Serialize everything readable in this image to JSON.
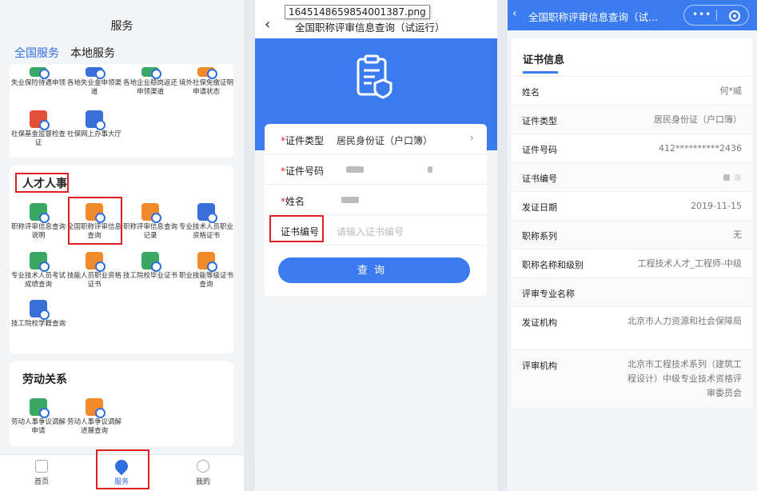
{
  "panel1": {
    "title": "服务",
    "tabs": [
      "全国服务",
      "本地服务"
    ],
    "top_items": [
      "失业保险待遇申领",
      "各地失业金申领渠道",
      "各地企业稳岗返还申领渠道",
      "境外社保免缴证明申请状态",
      "社保基金监督检查证",
      "社保网上办事大厅"
    ],
    "section_talent": "人才人事",
    "talent_items": [
      "职称评审信息查询说明",
      "全国职称评审信息查询",
      "职称评审信息查询记录",
      "专业技术人员职业资格证书",
      "专业技术人员考试成绩查询",
      "技能人员职业资格证书",
      "技工院校毕业证书",
      "职业技能等级证书查询",
      "技工院校学籍查询"
    ],
    "section_labor": "劳动关系",
    "labor_items": [
      "劳动人事争议调解申请",
      "劳动人事争议调解进展查询"
    ],
    "nav": [
      "首页",
      "服务",
      "我的"
    ]
  },
  "panel2": {
    "tooltip": "1645148659854001387.png",
    "title": "全国职称评审信息查询（试运行）",
    "form": {
      "type_label": "证件类型",
      "type_value": "居民身份证（户口簿）",
      "id_label": "证件号码",
      "name_label": "姓名",
      "cert_label": "证书编号",
      "cert_placeholder": "请输入证书编号",
      "query_button": "查询"
    }
  },
  "panel3": {
    "title": "全国职称评审信息查询（试...",
    "tab": "证书信息",
    "rows": [
      {
        "k": "姓名",
        "v": "何*威"
      },
      {
        "k": "证件类型",
        "v": "居民身份证（户口簿）"
      },
      {
        "k": "证件号码",
        "v": "412**********2436"
      },
      {
        "k": "证书编号",
        "v": ""
      },
      {
        "k": "发证日期",
        "v": "2019-11-15"
      },
      {
        "k": "职称系列",
        "v": "无"
      },
      {
        "k": "职称名称和级别",
        "v": "工程技术人才_工程师-中级"
      },
      {
        "k": "评审专业名称",
        "v": ""
      },
      {
        "k": "发证机构",
        "v": "北京市人力资源和社会保障局"
      },
      {
        "k": "评审机构",
        "v": "北京市工程技术系列（建筑工程设计）中级专业技术资格评审委员会"
      }
    ]
  },
  "colors": {
    "accent": "#3a7cef",
    "highlight": "#e02020"
  }
}
